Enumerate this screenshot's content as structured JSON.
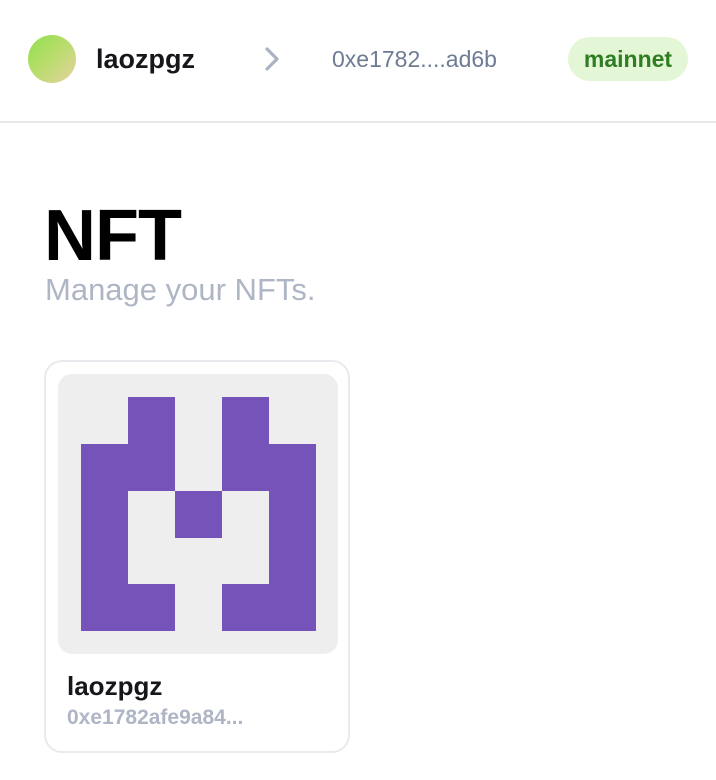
{
  "header": {
    "account_name": "laozpgz",
    "address": "0xe1782....ad6b",
    "network": "mainnet",
    "avatar_icon": "gradient-avatar",
    "separator_icon": "chevron-right-icon"
  },
  "page": {
    "title": "NFT",
    "subtitle": "Manage your NFTs."
  },
  "nfts": [
    {
      "name": "laozpgz",
      "address": "0xe1782afe9a84...",
      "image_icon": "pixel-logo-icon",
      "image_color": "#7653b8",
      "image_background": "#eeeeee"
    }
  ],
  "colors": {
    "network_badge_bg": "#e3f6d6",
    "network_badge_text": "#2f7d23",
    "muted_text": "#aeb5c5",
    "address_text": "#6e7b93"
  }
}
